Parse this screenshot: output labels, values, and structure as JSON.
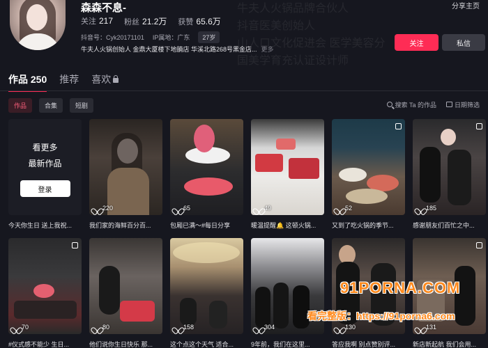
{
  "profile": {
    "name": "森森不息-",
    "stats": [
      {
        "label": "关注",
        "value": "217"
      },
      {
        "label": "粉丝",
        "value": "21.2万"
      },
      {
        "label": "获赞",
        "value": "65.6万"
      }
    ],
    "douyin_id": "抖音号：Cyk20171101",
    "ip": "IP属地：广东",
    "age": "27岁",
    "bio": "牛夫人火锅创始人 金鼎大厦楼下地腩店 华溪北路268号黑金店...",
    "bio_more": "更多",
    "bg_bio_lines": [
      "牛夫人火锅品牌合伙人",
      "抖音医美创始人",
      "山人口文化促进会 医学美容分",
      "国美学育充认证设计师"
    ]
  },
  "header_actions": {
    "share": "分享主页",
    "follow": "关注",
    "message": "私信"
  },
  "tabs": [
    {
      "label": "作品 250",
      "active": true
    },
    {
      "label": "推荐",
      "active": false
    },
    {
      "label": "喜欢",
      "active": false,
      "locked": true
    }
  ],
  "filters": {
    "chips": [
      {
        "label": "作品",
        "active": true
      },
      {
        "label": "合集",
        "active": false
      },
      {
        "label": "短剧",
        "active": false
      }
    ],
    "search": "搜索 Ta 的作品",
    "date_filter": "日期筛选"
  },
  "login_card": {
    "line1": "看更多",
    "line2": "最新作品",
    "button": "登录"
  },
  "videos": [
    {
      "likes": "220",
      "caption": "我们家的海鲜百分百..."
    },
    {
      "likes": "65",
      "caption": "包厢已满～#每日分享"
    },
    {
      "likes": "49",
      "caption": "暖温提醒🔔 这顿火锅..."
    },
    {
      "likes": "52",
      "caption": "又到了吃火锅的季节..."
    },
    {
      "likes": "185",
      "caption": "感谢朋友们百忙之中..."
    },
    {
      "likes": "70",
      "caption": "#仪式感不能少 生日..."
    },
    {
      "likes": "80",
      "caption": "他们说你生日快乐 那..."
    },
    {
      "likes": "158",
      "caption": "这个点这个天气 适合..."
    },
    {
      "likes": "304",
      "caption": "9年前，我们在这里..."
    },
    {
      "likes": "130",
      "caption": "答应我啊 别点赞别评..."
    },
    {
      "likes": "131",
      "caption": "新店新起航 我们会用..."
    }
  ],
  "first_caption": "今天你生日 送上我祝...",
  "watermark": {
    "line1": "91PORNA.COM",
    "line2": "看完整版：https://91porna6.com"
  },
  "colors": {
    "background": "#16171f",
    "accent": "#fe2c55",
    "watermark": "#ff8a1e"
  }
}
